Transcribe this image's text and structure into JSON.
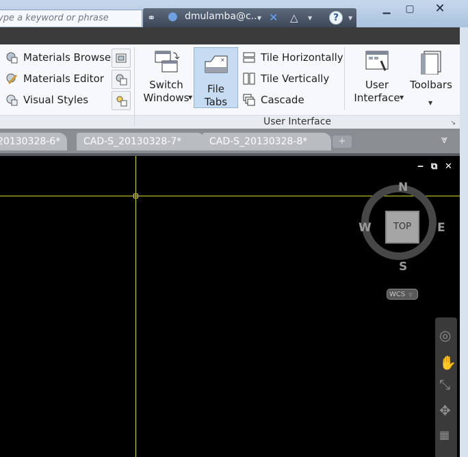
{
  "titlebar": {
    "search_placeholder": "ype a keyword or phrase",
    "user_name": "dmulamba@c...",
    "icons": [
      "binoculars-icon",
      "user-icon",
      "exchange-x-icon",
      "a360-triangle-icon",
      "help-icon"
    ],
    "window_buttons": [
      "minimize",
      "maximize",
      "close"
    ]
  },
  "ribbon": {
    "palettes_list": [
      {
        "label": "Materials Browser",
        "icon": "materials-browser-icon"
      },
      {
        "label": "Materials Editor",
        "icon": "materials-editor-icon"
      },
      {
        "label": "Visual Styles",
        "icon": "visual-styles-icon"
      }
    ],
    "switch_windows": {
      "line1": "Switch",
      "line2": "Windows"
    },
    "file_tabs": {
      "label": "File Tabs"
    },
    "window_list": [
      {
        "label": "Tile Horizontally"
      },
      {
        "label": "Tile Vertically"
      },
      {
        "label": "Cascade"
      }
    ],
    "user_interface": {
      "line1": "User",
      "line2": "Interface"
    },
    "toolbars": {
      "label": "Toolbars"
    },
    "panel_label": "User Interface"
  },
  "file_tabs": {
    "tabs": [
      "20130328-6*",
      "CAD-S_20130328-7*",
      "CAD-S_20130328-8*"
    ]
  },
  "viewport": {
    "viewcube": {
      "n": "N",
      "s": "S",
      "e": "E",
      "w": "W",
      "face": "TOP"
    },
    "wcs_label": "WCS",
    "colors": {
      "background": "#000000",
      "crosshair": "#d9d22a"
    }
  }
}
